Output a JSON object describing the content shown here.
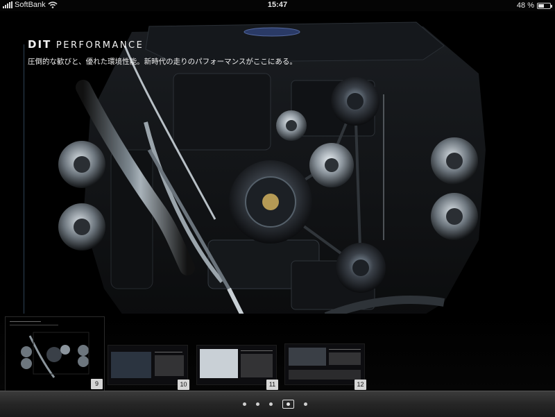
{
  "status_bar": {
    "carrier": "SoftBank",
    "time": "15:47",
    "battery_percent_text": "48 %",
    "battery_level": 0.48,
    "icons": [
      "signal-icon",
      "wifi-icon",
      "battery-icon"
    ]
  },
  "page": {
    "heading": "DIT PERFORMANCE",
    "subheading": "圧倒的な歓びと、優れた環境性能。新時代の走りのパフォーマンスがここにある。",
    "image": "engine-photo"
  },
  "thumbnails": [
    {
      "page_number": "9",
      "selected": true
    },
    {
      "page_number": "10",
      "selected": false
    },
    {
      "page_number": "11",
      "selected": false
    },
    {
      "page_number": "12",
      "selected": false
    }
  ],
  "pagination": {
    "dots": 5,
    "current_index": 3
  },
  "colors": {
    "background": "#000000",
    "accent_line": "#2e4256",
    "bottom_bar": "#2a2a2a"
  }
}
